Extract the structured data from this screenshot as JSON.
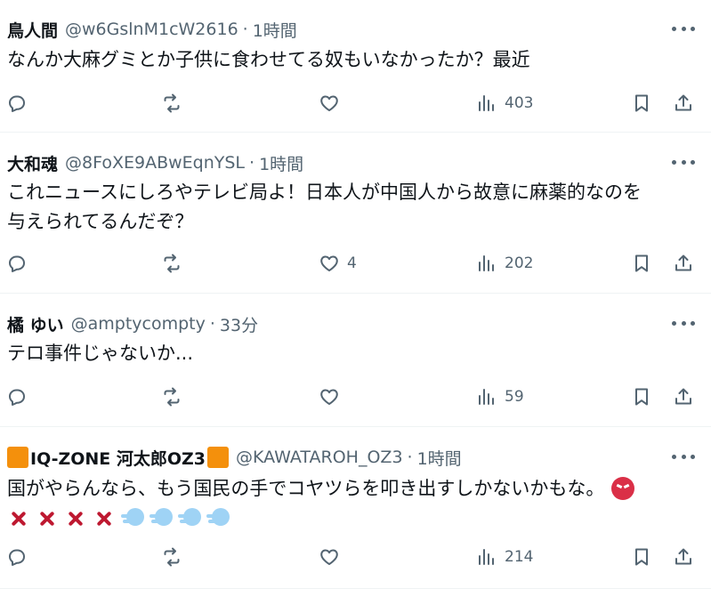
{
  "posts": [
    {
      "name": "鳥人間",
      "handle": "@w6GslnM1cW2616",
      "separator": "·",
      "time": "1時間",
      "lines": [
        "なんか大麻グミとか子供に食わせてる奴もいなかったか？最近"
      ],
      "likes": "",
      "views": "403"
    },
    {
      "name": "大和魂",
      "handle": "@8FoXE9ABwEqnYSL",
      "separator": "·",
      "time": "1時間",
      "lines": [
        "これニュースにしろやテレビ局よ！日本人が中国人から故意に麻薬的なのを",
        "与えられてるんだぞ？"
      ],
      "likes": "4",
      "views": "202"
    },
    {
      "name": "橘 ゆい",
      "handle": "@amptycompty",
      "separator": "·",
      "time": "33分",
      "lines": [
        "テロ事件じゃないか..."
      ],
      "likes": "",
      "views": "59"
    },
    {
      "name": "IQ-ZONE 河太郎OZ3",
      "handle": "@KAWATAROH_OZ3",
      "separator": "·",
      "time": "1時間",
      "lines": [
        "国がやらんなら、もう国民の手でコヤツらを叩き出すしかないかもな。"
      ],
      "likes": "",
      "views": "214"
    }
  ],
  "icons": {
    "more": "more-horizontal-icon",
    "reply": "reply-bubble-icon",
    "repost": "repost-icon",
    "like": "heart-icon",
    "views": "views-bar-chart-icon",
    "bookmark": "bookmark-icon",
    "share": "share-icon",
    "name_decoration": "orange-square-emoji",
    "angry": "angry-face-emoji",
    "anger": "anger-symbol-emoji",
    "dash": "dashing-away-emoji"
  },
  "colors": {
    "text": "#0f1419",
    "secondary": "#536471",
    "divider": "#eff3f4",
    "emoji_orange": "#f4900c"
  }
}
